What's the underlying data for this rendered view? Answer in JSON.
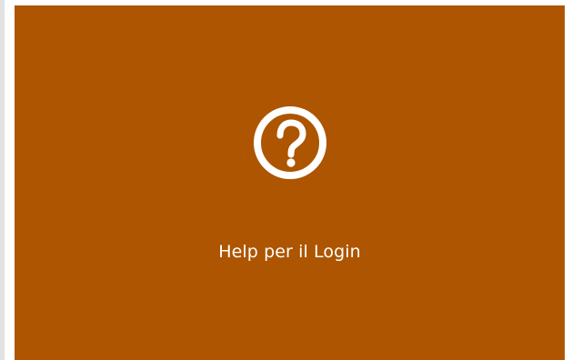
{
  "tile": {
    "label": "Help per il Login",
    "icon": "question-circle-icon",
    "background_color": "#ad5500",
    "foreground_color": "#ffffff"
  }
}
